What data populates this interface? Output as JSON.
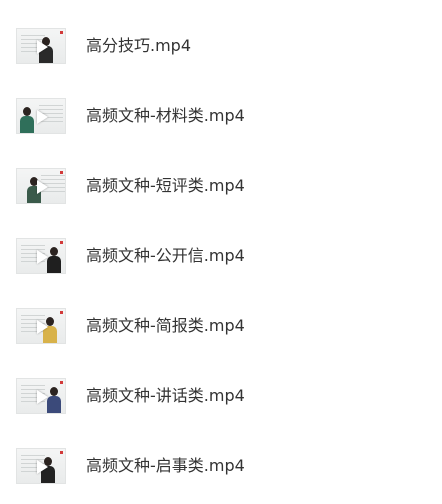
{
  "files": [
    {
      "name": "高分技巧.mp4",
      "thumb_icon": "video-thumbnail-icon",
      "torso_color": "#2a2a2a"
    },
    {
      "name": "高频文种-材料类.mp4",
      "thumb_icon": "video-thumbnail-icon",
      "torso_color": "#2f6f5a"
    },
    {
      "name": "高频文种-短评类.mp4",
      "thumb_icon": "video-thumbnail-icon",
      "torso_color": "#3a5a4a"
    },
    {
      "name": "高频文种-公开信.mp4",
      "thumb_icon": "video-thumbnail-icon",
      "torso_color": "#1f1f1f"
    },
    {
      "name": "高频文种-简报类.mp4",
      "thumb_icon": "video-thumbnail-icon",
      "torso_color": "#d8b24a"
    },
    {
      "name": "高频文种-讲话类.mp4",
      "thumb_icon": "video-thumbnail-icon",
      "torso_color": "#3b4a7a"
    },
    {
      "name": "高频文种-启事类.mp4",
      "thumb_icon": "video-thumbnail-icon",
      "torso_color": "#222222"
    }
  ]
}
